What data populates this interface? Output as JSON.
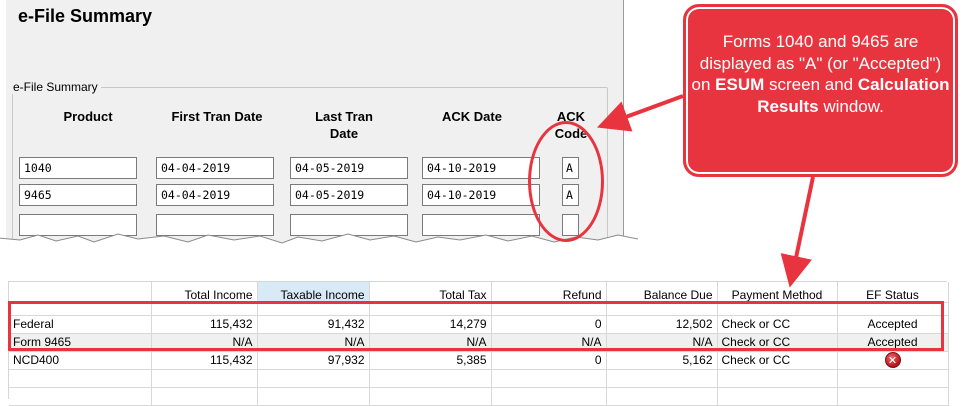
{
  "esum": {
    "title": "e-File Summary",
    "group_label": "e-File Summary",
    "columns": {
      "product": "Product",
      "first_tran_date": "First Tran Date",
      "last_tran_line1": "Last Tran",
      "last_tran_line2": "Date",
      "ack_date": "ACK Date",
      "ack_code_line1": "ACK",
      "ack_code_line2": "Code"
    },
    "rows": [
      {
        "product": "1040",
        "first": "04-04-2019",
        "last": "04-05-2019",
        "ack_date": "04-10-2019",
        "code": "A"
      },
      {
        "product": "9465",
        "first": "04-04-2019",
        "last": "04-05-2019",
        "ack_date": "04-10-2019",
        "code": "A"
      }
    ]
  },
  "callout": {
    "p1": "Forms 1040 and 9465 are displayed as \"A\" (or \"Accepted\") on ",
    "b1": "ESUM",
    "p2": " screen and ",
    "b2": "Calculation Results",
    "p3": " window."
  },
  "results": {
    "headers": [
      "",
      "Total Income",
      "Taxable Income",
      "Total Tax",
      "Refund",
      "Balance Due",
      "Payment Method",
      "EF Status"
    ],
    "rows": [
      [
        "Federal",
        "115,432",
        "91,432",
        "14,279",
        "0",
        "12,502",
        "Check or CC",
        "Accepted"
      ],
      [
        "Form 9465",
        "N/A",
        "N/A",
        "N/A",
        "N/A",
        "N/A",
        "Check or CC",
        "Accepted"
      ],
      [
        "NCD400",
        "115,432",
        "97,932",
        "5,385",
        "0",
        "5,162",
        "Check or CC",
        ""
      ]
    ],
    "error_icon": "error-x-icon"
  },
  "colors": {
    "accent": "#e8343f",
    "panel_bg": "#f0f0f0",
    "sorted_header": "#d9eaf7"
  }
}
